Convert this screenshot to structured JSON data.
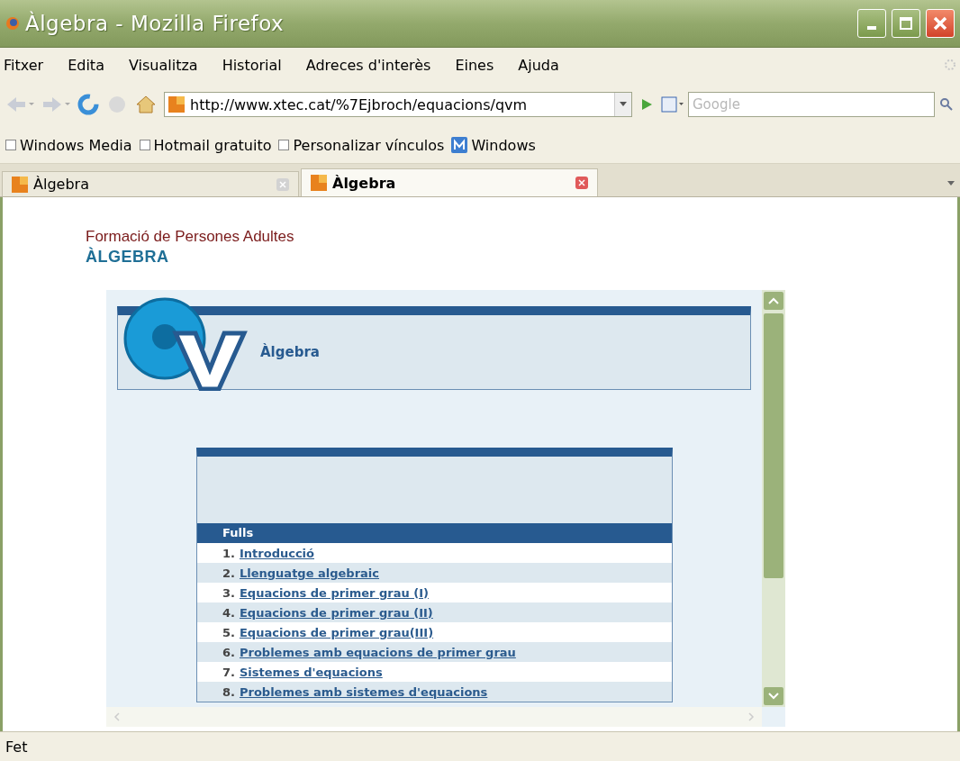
{
  "window": {
    "title": "Àlgebra - Mozilla Firefox"
  },
  "menu": [
    "Fitxer",
    "Edita",
    "Visualitza",
    "Historial",
    "Adreces d'interès",
    "Eines",
    "Ajuda"
  ],
  "address_bar": {
    "value": "http://www.xtec.cat/%7Ejbroch/equacions/qvm"
  },
  "search": {
    "placeholder": "Google"
  },
  "bookmarks": [
    {
      "label": "Windows Media",
      "kind": "page"
    },
    {
      "label": "Hotmail gratuito",
      "kind": "page"
    },
    {
      "label": "Personalizar vínculos",
      "kind": "page"
    },
    {
      "label": "Windows",
      "kind": "site"
    }
  ],
  "tabs": [
    {
      "label": "Àlgebra",
      "selected": false
    },
    {
      "label": "Àlgebra",
      "selected": true
    }
  ],
  "page": {
    "organization": "Formació de Persones Adultes",
    "heading": "ÀLGEBRA",
    "quad_title": "Àlgebra",
    "list_header": "Fulls",
    "items": [
      {
        "number": "1.",
        "title": "Introducció"
      },
      {
        "number": "2.",
        "title": "Llenguatge algebraic"
      },
      {
        "number": "3.",
        "title": "Equacions de primer grau (I)"
      },
      {
        "number": "4.",
        "title": "Equacions de primer grau (II)"
      },
      {
        "number": "5.",
        "title": "Equacions de primer grau(III)"
      },
      {
        "number": "6.",
        "title": "Problemes amb equacions de primer grau"
      },
      {
        "number": "7.",
        "title": "Sistemes d'equacions"
      },
      {
        "number": "8.",
        "title": "Problemes amb sistemes d'equacions"
      }
    ]
  },
  "status_bar": "Fet"
}
